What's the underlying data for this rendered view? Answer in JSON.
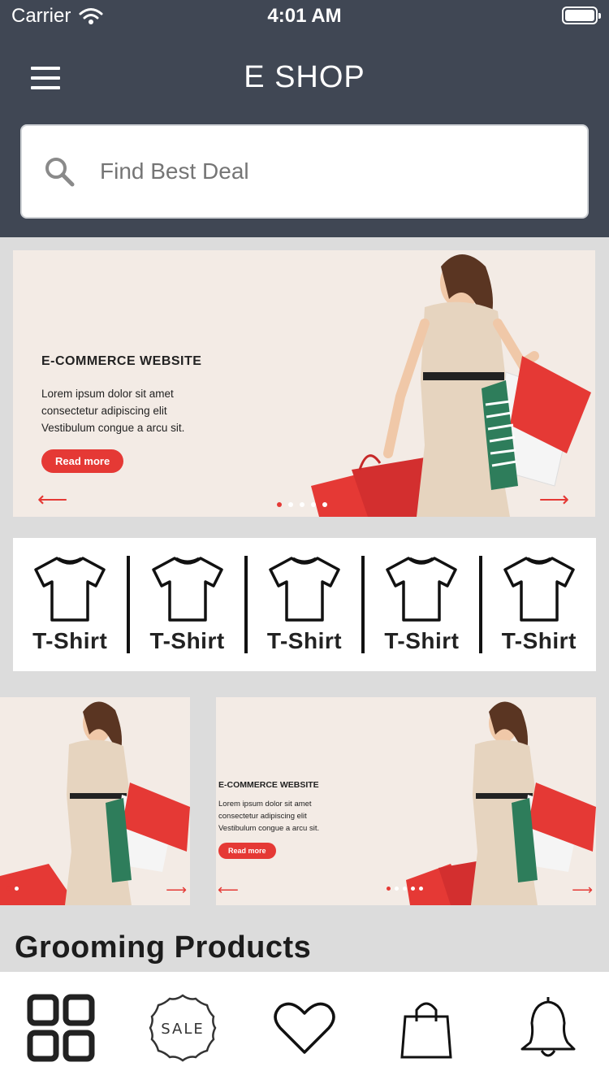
{
  "status_bar": {
    "carrier": "Carrier",
    "time": "4:01 AM"
  },
  "header": {
    "title": "E SHOP"
  },
  "search": {
    "placeholder": "Find Best Deal"
  },
  "banner": {
    "title": "E-COMMERCE WEBSITE",
    "body_line1": "Lorem ipsum dolor sit amet",
    "body_line2": "consectetur adipiscing elit",
    "body_line3": "Vestibulum congue a arcu sit.",
    "button": "Read more",
    "left_arrow": "⟵",
    "right_arrow": "⟶"
  },
  "categories": [
    {
      "label": "T-Shirt"
    },
    {
      "label": "T-Shirt"
    },
    {
      "label": "T-Shirt"
    },
    {
      "label": "T-Shirt"
    },
    {
      "label": "T-Shirt"
    }
  ],
  "promo": {
    "title": "E-COMMERCE WEBSITE",
    "body_line1": "Lorem ipsum dolor sit amet",
    "body_line2": "consectetur adipiscing elit",
    "body_line3": "Vestibulum congue a arcu sit.",
    "button": "Read more",
    "left_arrow": "⟵",
    "right_arrow": "⟶"
  },
  "section": {
    "title": "Grooming Products"
  },
  "tabbar": {
    "items": [
      {
        "icon": "grid-icon"
      },
      {
        "icon": "sale-badge-icon",
        "text": "SALE"
      },
      {
        "icon": "heart-icon"
      },
      {
        "icon": "shopping-bag-icon"
      },
      {
        "icon": "bell-icon"
      }
    ]
  },
  "colors": {
    "header_bg": "#404754",
    "accent": "#e53935",
    "banner_bg": "#f3ebe5"
  }
}
